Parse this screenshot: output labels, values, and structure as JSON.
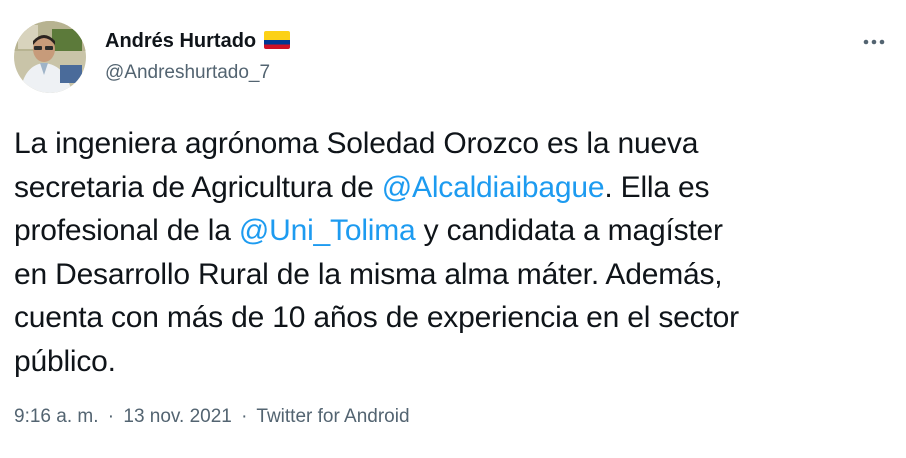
{
  "user": {
    "display_name": "Andrés Hurtado",
    "handle": "@Andreshurtado_7",
    "flag_icon": "colombia-flag-icon"
  },
  "tweet": {
    "lines": [
      {
        "pre": "La ingeniera agrónoma Soledad Orozco es la nueva",
        "mention": "",
        "post": ""
      },
      {
        "pre": "secretaria de Agricultura de ",
        "mention": "@Alcaldiaibague",
        "post": ". Ella es"
      },
      {
        "pre": "profesional de la ",
        "mention": "@Uni_Tolima",
        "post": " y candidata a magíster"
      },
      {
        "pre": "en Desarrollo Rural de la misma alma máter. Además,",
        "mention": "",
        "post": ""
      },
      {
        "pre": "cuenta con más de 10 años de experiencia en el sector",
        "mention": "",
        "post": ""
      },
      {
        "pre": "público.",
        "mention": "",
        "post": ""
      }
    ]
  },
  "meta": {
    "time": "9:16 a. m.",
    "separator": "·",
    "date": "13 nov. 2021",
    "source": "Twitter for Android"
  },
  "colors": {
    "text": "#0f1419",
    "secondary": "#536471",
    "link": "#1d9bf0"
  }
}
